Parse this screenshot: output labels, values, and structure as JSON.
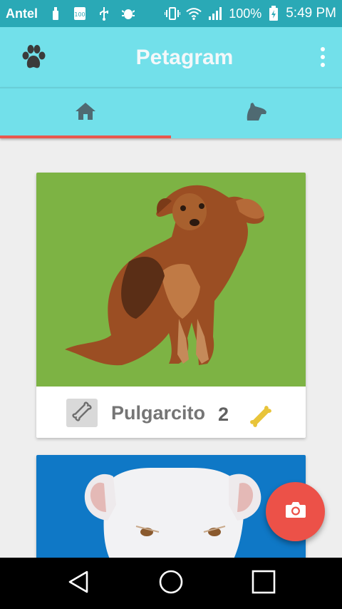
{
  "status_bar": {
    "carrier": "Antel",
    "battery_percent": "100%",
    "time": "5:49 PM",
    "icons": [
      "usb-icon",
      "battery-100-icon",
      "usb-icon",
      "android-debug-icon",
      "vibrate-icon",
      "wifi-icon",
      "signal-icon",
      "battery-charging-icon"
    ]
  },
  "app_bar": {
    "title": "Petagram",
    "left_icon": "paw-icon",
    "right_icon": "more-vert-icon"
  },
  "tabs": [
    {
      "icon": "home-icon",
      "selected": true
    },
    {
      "icon": "dog-icon",
      "selected": false
    }
  ],
  "pets": [
    {
      "name": "Pulgarcito",
      "likes": "2",
      "photo": "brown dog on green background"
    },
    {
      "name": "",
      "likes": "",
      "photo": "white dog on blue background"
    }
  ],
  "fab": {
    "icon": "camera-icon"
  },
  "colors": {
    "status_bar": "#2aa9b6",
    "app_bar": "#72e0ea",
    "tab_indicator": "#e9574d",
    "fab": "#ec5148",
    "card1_bg": "#7db344",
    "card2_bg": "#0f78c6",
    "bone_like": "#e8c43a"
  },
  "nav_bar": {
    "buttons": [
      "back-icon",
      "home-circle-icon",
      "recents-icon"
    ]
  }
}
